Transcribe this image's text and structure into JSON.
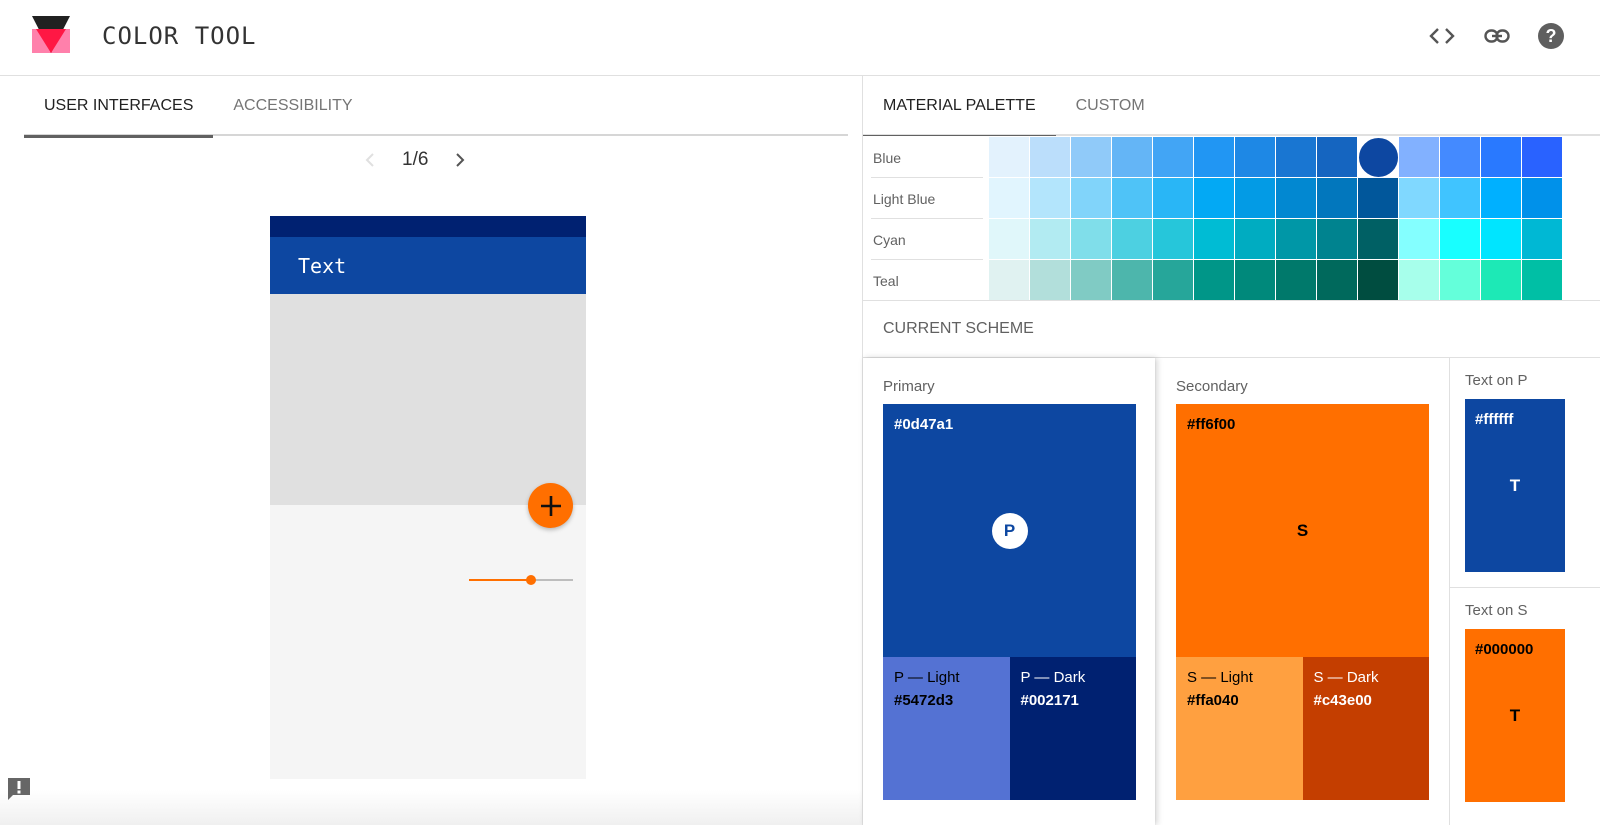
{
  "header": {
    "title": "COLOR TOOL",
    "icons": [
      "code-icon",
      "link-icon",
      "help-icon"
    ]
  },
  "left_panel": {
    "tabs": [
      {
        "label": "USER INTERFACES",
        "active": true
      },
      {
        "label": "ACCESSIBILITY",
        "active": false
      }
    ],
    "pager": {
      "text": "1/6",
      "current": 1,
      "total": 6
    },
    "preview": {
      "appbar_text": "Text",
      "fab_icon": "plus-icon",
      "slider_value_percent": 60
    }
  },
  "right_panel": {
    "tabs": [
      {
        "label": "MATERIAL PALETTE",
        "active": true
      },
      {
        "label": "CUSTOM",
        "active": false
      }
    ],
    "palette": {
      "rows": [
        {
          "name": "Blue",
          "swatches": [
            "#e3f2fd",
            "#bbdefb",
            "#90caf9",
            "#64b5f6",
            "#42a5f5",
            "#2196f3",
            "#1e88e5",
            "#1976d2",
            "#1565c0",
            "#0d47a1",
            "#82b1ff",
            "#448aff",
            "#2979ff",
            "#2962ff"
          ],
          "selected_index": 9
        },
        {
          "name": "Light Blue",
          "swatches": [
            "#e1f5fe",
            "#b3e5fc",
            "#81d4fa",
            "#4fc3f7",
            "#29b6f6",
            "#03a9f4",
            "#039be5",
            "#0288d1",
            "#0277bd",
            "#01579b",
            "#80d8ff",
            "#40c4ff",
            "#00b0ff",
            "#0091ea"
          ]
        },
        {
          "name": "Cyan",
          "swatches": [
            "#e0f7fa",
            "#b2ebf2",
            "#80deea",
            "#4dd0e1",
            "#26c6da",
            "#00bcd4",
            "#00acc1",
            "#0097a7",
            "#00838f",
            "#006064",
            "#84ffff",
            "#18ffff",
            "#00e5ff",
            "#00b8d4"
          ]
        },
        {
          "name": "Teal",
          "swatches": [
            "#e0f2f1",
            "#b2dfdb",
            "#80cbc4",
            "#4db6ac",
            "#26a69a",
            "#009688",
            "#00897b",
            "#00796b",
            "#00695c",
            "#004d40",
            "#a7ffeb",
            "#64ffda",
            "#1de9b6",
            "#00bfa5"
          ]
        }
      ]
    },
    "scheme": {
      "heading": "CURRENT SCHEME",
      "primary": {
        "label": "Primary",
        "hex": "#0d47a1",
        "mark": "P",
        "light": {
          "name": "P — Light",
          "hex": "#5472d3"
        },
        "dark": {
          "name": "P — Dark",
          "hex": "#002171"
        }
      },
      "secondary": {
        "label": "Secondary",
        "hex": "#ff6f00",
        "mark": "S",
        "light": {
          "name": "S — Light",
          "hex": "#ffa040"
        },
        "dark": {
          "name": "S — Dark",
          "hex": "#c43e00"
        }
      },
      "text_on_p": {
        "label": "Text on P",
        "hex": "#ffffff",
        "mark": "T"
      },
      "text_on_s": {
        "label": "Text on S",
        "hex": "#000000",
        "mark": "T"
      }
    }
  }
}
